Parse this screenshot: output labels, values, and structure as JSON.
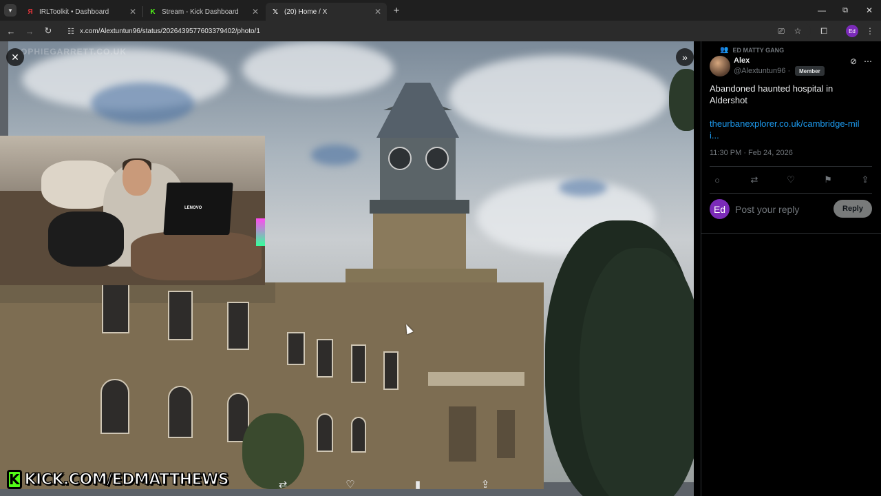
{
  "browser": {
    "tabs": [
      {
        "title": "IRLToolkit • Dashboard",
        "icon": "irltoolkit-icon",
        "icon_glyph": "Я",
        "icon_color": "#e0343a"
      },
      {
        "title": "Stream - Kick Dashboard",
        "icon": "kick-icon",
        "icon_glyph": "K",
        "icon_color": "#53fc18"
      },
      {
        "title": "(20) Home / X",
        "icon": "x-logo-icon",
        "icon_glyph": "𝕏",
        "icon_color": "#ffffff"
      }
    ],
    "url": "x.com/Alextuntun96/status/2026439577603379402/photo/1",
    "profile_initials": "Ed"
  },
  "media": {
    "watermark": "OPHIEGARRETT.CO.UK",
    "overlay_banner": "KICK.COM/EDMATTHEWS",
    "laptop_logo": "LENOVO"
  },
  "tweet": {
    "community": "ED MATTY GANG",
    "author_name": "Alex",
    "author_handle": "@Alextuntun96",
    "separator": "·",
    "badge": "Member",
    "text": "Abandoned haunted hospital in Aldershot",
    "link": "theurbanexplorer.co.uk/cambridge-mili...",
    "timestamp": "11:30 PM · Feb 24, 2026",
    "reply_avatar_initials": "Ed",
    "reply_placeholder": "Post your reply",
    "reply_button": "Reply"
  },
  "colors": {
    "accent_link": "#1d9bf0",
    "kick_green": "#53fc18",
    "profile_purple": "#7b2bb8"
  }
}
